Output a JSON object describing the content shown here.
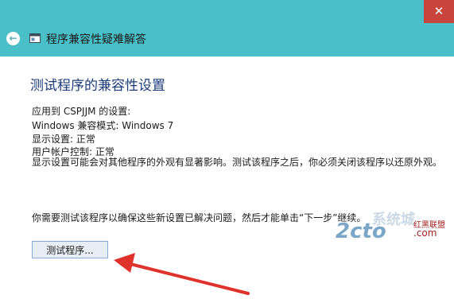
{
  "window": {
    "title": "程序兼容性疑难解答",
    "close_glyph": "✕",
    "back_glyph": "←"
  },
  "content": {
    "heading": "测试程序的兼容性设置",
    "applied_to": "应用到  CSPJJM 的设置:",
    "compat_mode": "Windows 兼容模式: Windows 7",
    "display_settings": "显示设置:  正常",
    "uac": "用户帐户控制:  正常",
    "note": "显示设置可能会对其他程序的外观有显著影响。测试该程序之后，你必须关闭该程序以还原外观。",
    "instruction": "你需要测试该程序以确保这些新设置已解决问题，然后才能单击“下一步”继续。",
    "test_button_label": "测试程序..."
  },
  "watermark": {
    "text_main": "2cto",
    "text_cn": "系统城",
    "text_sub": "红黑联盟",
    "text_com": ".com"
  },
  "colors": {
    "titlebar": "#4bbfc7",
    "close": "#c8443c",
    "heading": "#1d3d7a",
    "arrow": "#e0322d"
  }
}
